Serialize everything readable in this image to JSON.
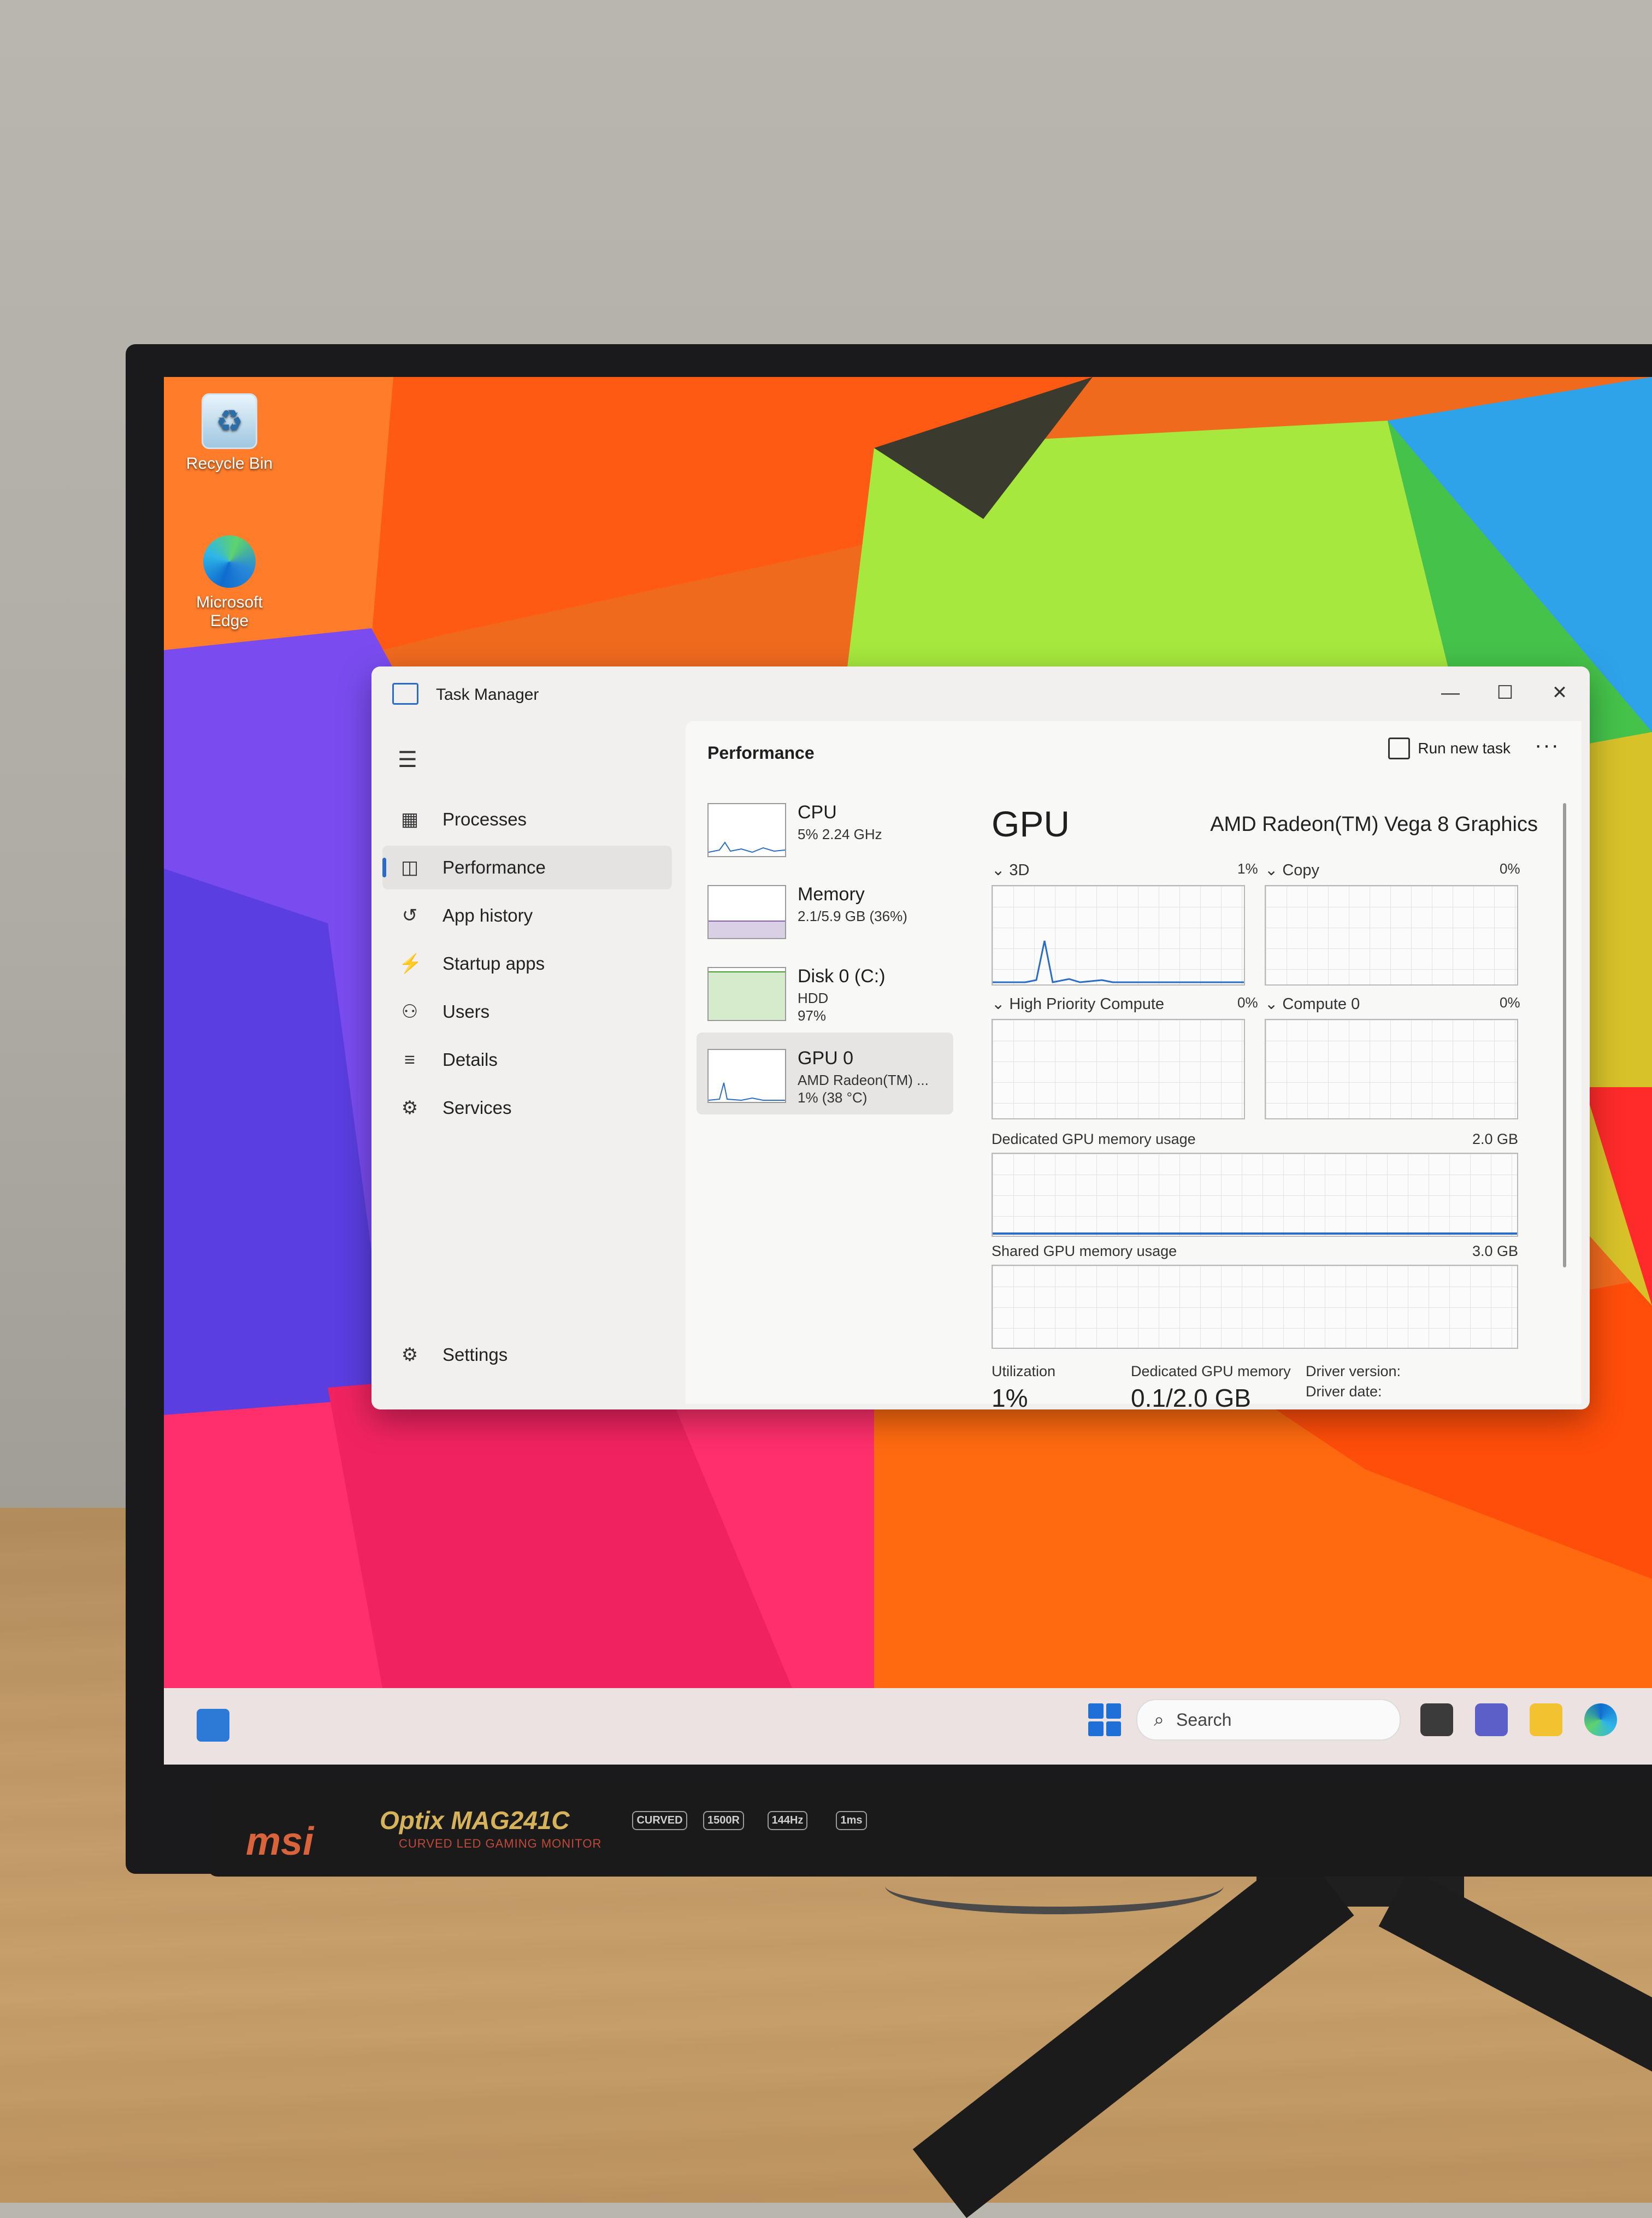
{
  "desktop": {
    "icons": [
      {
        "label": "Recycle Bin"
      },
      {
        "label": "Microsoft Edge"
      }
    ]
  },
  "task_manager": {
    "title": "Task Manager",
    "nav": {
      "processes": "Processes",
      "performance": "Performance",
      "app_history": "App history",
      "startup_apps": "Startup apps",
      "users": "Users",
      "details": "Details",
      "services": "Services",
      "settings": "Settings"
    },
    "header": {
      "title": "Performance",
      "run_new_task": "Run new task",
      "more": "···"
    },
    "resources": [
      {
        "name": "CPU",
        "line1": "5% 2.24 GHz",
        "line2": ""
      },
      {
        "name": "Memory",
        "line1": "2.1/5.9 GB (36%)",
        "line2": ""
      },
      {
        "name": "Disk 0 (C:)",
        "line1": "HDD",
        "line2": "97%"
      },
      {
        "name": "GPU 0",
        "line1": "AMD Radeon(TM) ...",
        "line2": "1% (38 °C)"
      }
    ],
    "gpu": {
      "title": "GPU",
      "model": "AMD Radeon(TM) Vega 8 Graphics",
      "engines": [
        {
          "label": "3D",
          "value": "1%"
        },
        {
          "label": "Copy",
          "value": "0%"
        },
        {
          "label": "High Priority Compute",
          "value": "0%"
        },
        {
          "label": "Compute 0",
          "value": "0%"
        }
      ],
      "dedicated_label": "Dedicated GPU memory usage",
      "dedicated_max": "2.0 GB",
      "shared_label": "Shared GPU memory usage",
      "shared_max": "3.0 GB",
      "stats": {
        "utilization_label": "Utilization",
        "utilization_value": "1%",
        "dedicated_label": "Dedicated GPU memory",
        "dedicated_value": "0.1/2.0 GB",
        "driver_version_label": "Driver version:",
        "driver_date_label": "Driver date:"
      }
    }
  },
  "taskbar": {
    "search_placeholder": "Search"
  },
  "monitor": {
    "brand": "msi",
    "model": "Optix MAG241C",
    "model_sub": "CURVED LED GAMING MONITOR",
    "badges": [
      "CURVED",
      "1500R",
      "144Hz",
      "1ms"
    ]
  }
}
